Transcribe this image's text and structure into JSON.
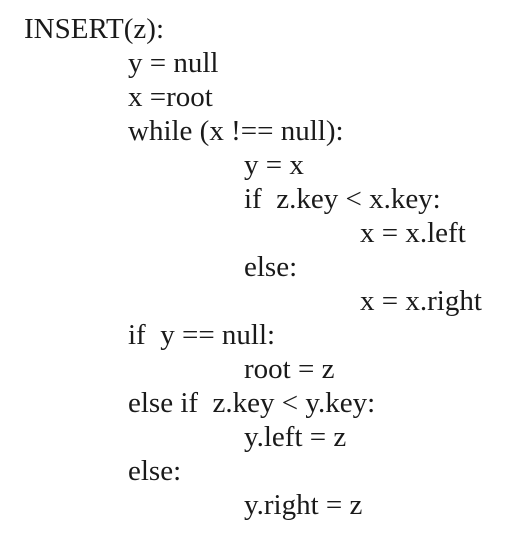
{
  "code": {
    "lines": [
      "INSERT(z):",
      "y = null",
      "x =root",
      "while (x !== null):",
      "y = x",
      "if  z.key < x.key:",
      "x = x.left",
      "else:",
      "x = x.right",
      "if  y == null:",
      "root = z",
      "else if  z.key < y.key:",
      "y.left = z",
      "else:",
      "y.right = z"
    ]
  }
}
